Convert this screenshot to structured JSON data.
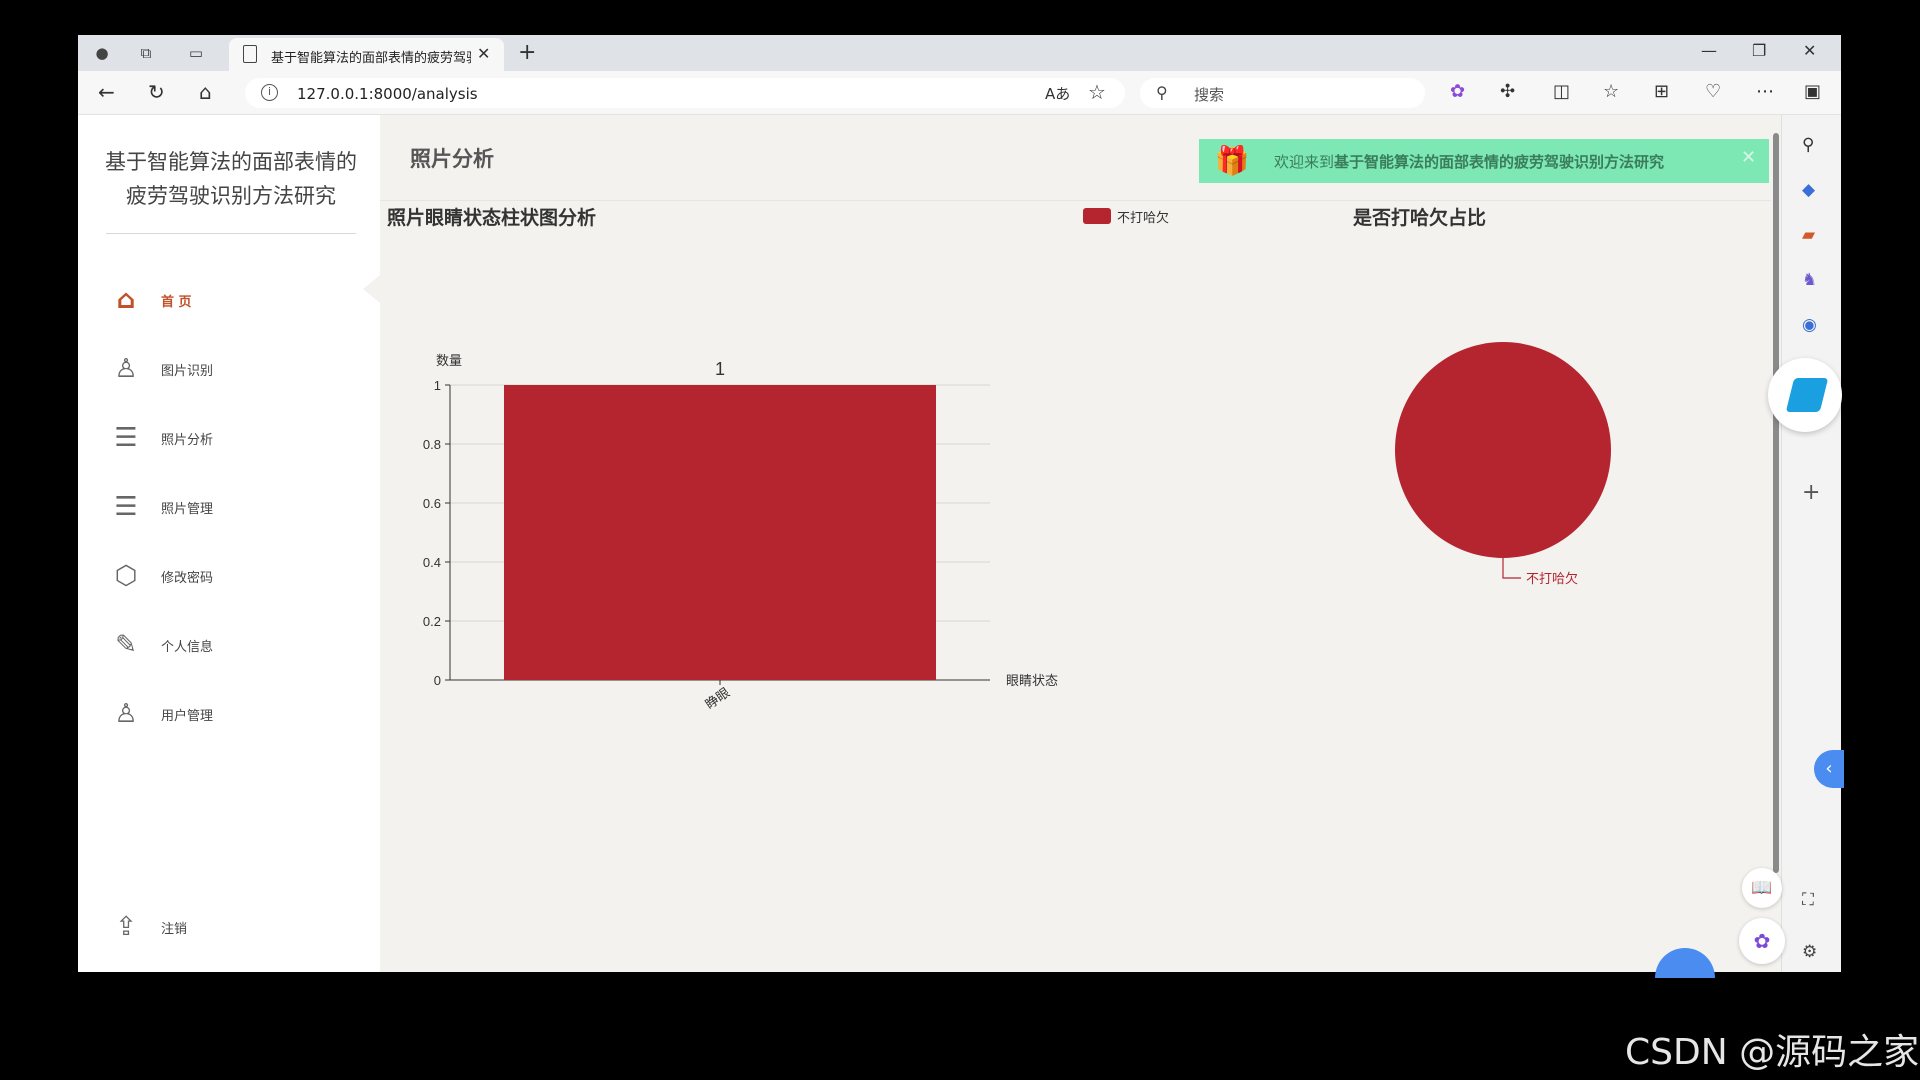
{
  "browser": {
    "tab_title": "基于智能算法的面部表情的疲劳驾驶识别方法研究",
    "new_tab_symbol": "+",
    "url": "127.0.0.1:8000/analysis",
    "search_placeholder": "搜索"
  },
  "sidebar": {
    "site_title": "基于智能算法的面部表情的疲劳驾驶识别方法研究",
    "items": [
      {
        "label": "首 页",
        "icon": "home-icon",
        "active": true
      },
      {
        "label": "图片识别",
        "icon": "user-icon",
        "active": false
      },
      {
        "label": "照片分析",
        "icon": "list-icon",
        "active": false
      },
      {
        "label": "照片管理",
        "icon": "list-icon",
        "active": false
      },
      {
        "label": "修改密码",
        "icon": "box-icon",
        "active": false
      },
      {
        "label": "个人信息",
        "icon": "pen-icon",
        "active": false
      },
      {
        "label": "用户管理",
        "icon": "user-icon",
        "active": false
      }
    ],
    "logout_label": "注销"
  },
  "header": {
    "page_title": "照片分析",
    "welcome_prefix": "欢迎来到",
    "welcome_site": "基于智能算法的面部表情的疲劳驾驶识别方法研究"
  },
  "chart_data": [
    {
      "type": "bar",
      "title": "照片眼睛状态柱状图分析",
      "xlabel": "眼睛状态",
      "ylabel": "数量",
      "categories": [
        "睁眼"
      ],
      "series": [
        {
          "name": "不打哈欠",
          "values": [
            1
          ]
        }
      ],
      "data_labels": [
        "1"
      ],
      "ylim": [
        0,
        1
      ],
      "yticks": [
        "0",
        "0.2",
        "0.4",
        "0.6",
        "0.8",
        "1"
      ],
      "grid": true,
      "legend": "top",
      "color": "#b5252f"
    },
    {
      "type": "pie",
      "title": "是否打哈欠占比",
      "labels": [
        "不打哈欠"
      ],
      "values": [
        1
      ],
      "color": "#b5252f"
    }
  ],
  "watermark": "CSDN @源码之家",
  "colors": {
    "accent": "#c0512a",
    "welcome_bg": "#7de8b4",
    "bar": "#b5252f"
  }
}
